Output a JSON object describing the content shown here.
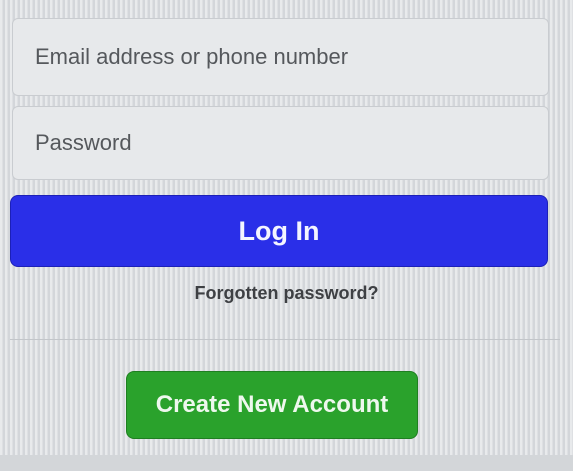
{
  "login_form": {
    "email": {
      "placeholder": "Email address or phone number",
      "value": ""
    },
    "password": {
      "placeholder": "Password",
      "value": ""
    },
    "login_label": "Log In",
    "forgot_label": "Forgotten password?",
    "create_account_label": "Create New Account"
  },
  "colors": {
    "primary_button": "#2a2fe8",
    "create_button": "#2aa22c"
  }
}
